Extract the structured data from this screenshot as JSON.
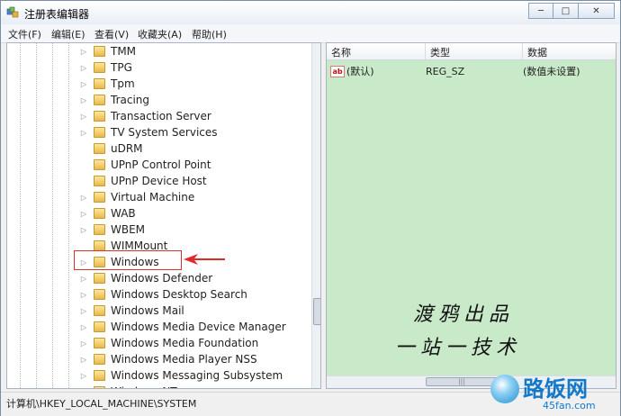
{
  "window": {
    "title": "注册表编辑器",
    "min_label": "─",
    "max_label": "□",
    "close_label": "✕"
  },
  "menu": [
    "文件(F)",
    "编辑(E)",
    "查看(V)",
    "收藏夹(A)",
    "帮助(H)"
  ],
  "tree": {
    "items": [
      {
        "label": "TMM",
        "expandable": true
      },
      {
        "label": "TPG",
        "expandable": true
      },
      {
        "label": "Tpm",
        "expandable": true
      },
      {
        "label": "Tracing",
        "expandable": true
      },
      {
        "label": "Transaction Server",
        "expandable": true
      },
      {
        "label": "TV System Services",
        "expandable": true
      },
      {
        "label": "uDRM",
        "expandable": false
      },
      {
        "label": "UPnP Control Point",
        "expandable": false
      },
      {
        "label": "UPnP Device Host",
        "expandable": false
      },
      {
        "label": "Virtual Machine",
        "expandable": true
      },
      {
        "label": "WAB",
        "expandable": true
      },
      {
        "label": "WBEM",
        "expandable": true
      },
      {
        "label": "WIMMount",
        "expandable": false
      },
      {
        "label": "Windows",
        "expandable": true,
        "highlighted": true
      },
      {
        "label": "Windows Defender",
        "expandable": true
      },
      {
        "label": "Windows Desktop Search",
        "expandable": true
      },
      {
        "label": "Windows Mail",
        "expandable": true
      },
      {
        "label": "Windows Media Device Manager",
        "expandable": true
      },
      {
        "label": "Windows Media Foundation",
        "expandable": true
      },
      {
        "label": "Windows Media Player NSS",
        "expandable": true
      },
      {
        "label": "Windows Messaging Subsystem",
        "expandable": true
      },
      {
        "label": "Windows NT",
        "expandable": true
      }
    ]
  },
  "list": {
    "columns": [
      "名称",
      "类型",
      "数据"
    ],
    "rows": [
      {
        "name": "(默认)",
        "type": "REG_SZ",
        "data": "(数值未设置)",
        "icon": "ab-string-icon"
      }
    ]
  },
  "watermark": {
    "line1": "渡鸦出品",
    "line2": "一站一技术"
  },
  "status": {
    "path": "计算机\\HKEY_LOCAL_MACHINE\\SYSTEM"
  },
  "logo": {
    "cn": "路饭网",
    "en": "45fan.com"
  },
  "colors": {
    "right_pane_bg": "#c9eac9",
    "highlight_box": "#d9342b",
    "logo_blue": "#1278c9"
  }
}
